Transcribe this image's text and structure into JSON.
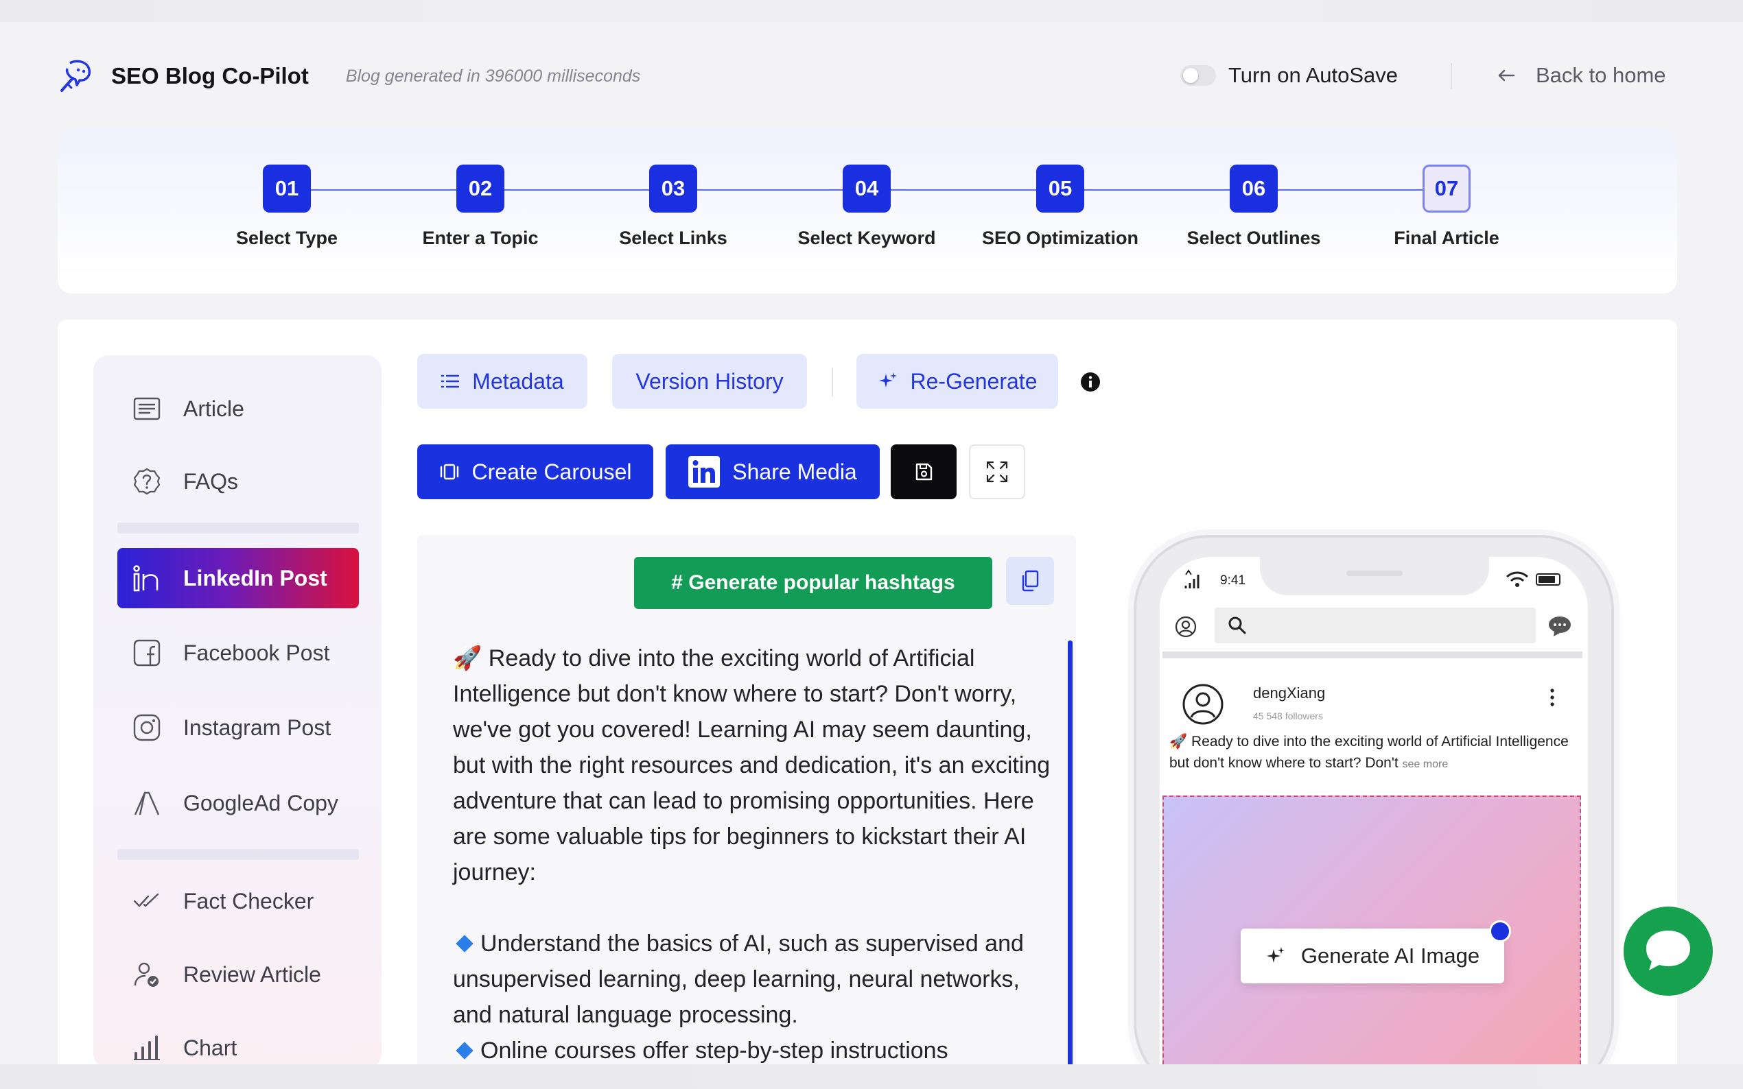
{
  "header": {
    "app_name": "SEO Blog Co-Pilot",
    "generated_note": "Blog generated in 396000 milliseconds",
    "autosave_label": "Turn on AutoSave",
    "autosave_on": false,
    "back_label": "Back to home"
  },
  "steps": [
    {
      "num": "01",
      "label": "Select Type",
      "state": "done"
    },
    {
      "num": "02",
      "label": "Enter a Topic",
      "state": "done"
    },
    {
      "num": "03",
      "label": "Select Links",
      "state": "done"
    },
    {
      "num": "04",
      "label": "Select Keyword",
      "state": "done"
    },
    {
      "num": "05",
      "label": "SEO Optimization",
      "state": "done"
    },
    {
      "num": "06",
      "label": "Select Outlines",
      "state": "done"
    },
    {
      "num": "07",
      "label": "Final Article",
      "state": "current"
    }
  ],
  "sidebar": {
    "items": [
      {
        "label": "Article",
        "icon": "article-icon"
      },
      {
        "label": "FAQs",
        "icon": "question-circle-icon"
      },
      {
        "label": "LinkedIn Post",
        "icon": "linkedin-icon",
        "active": true
      },
      {
        "label": "Facebook Post",
        "icon": "facebook-icon"
      },
      {
        "label": "Instagram Post",
        "icon": "instagram-icon"
      },
      {
        "label": "GoogleAd Copy",
        "icon": "google-ads-icon"
      },
      {
        "label": "Fact Checker",
        "icon": "double-check-icon"
      },
      {
        "label": "Review Article",
        "icon": "user-check-icon"
      },
      {
        "label": "Chart",
        "icon": "bar-chart-icon"
      }
    ]
  },
  "toolbar": {
    "metadata": "Metadata",
    "version_history": "Version History",
    "regenerate": "Re-Generate",
    "create_carousel": "Create Carousel",
    "share_media": "Share Media"
  },
  "editor": {
    "hashtag_button": "# Generate popular hashtags",
    "paragraphs": [
      "Ready to dive into the exciting world of Artificial Intelligence but don't know where to start? Don't worry, we've got you covered! Learning AI may seem daunting, but with the right resources and dedication, it's an exciting adventure that can lead to promising opportunities. Here are some valuable tips for beginners to kickstart their AI journey:",
      "Understand the basics of AI, such as supervised and unsupervised learning, deep learning, neural networks, and natural language processing.",
      "Online courses offer step-by-step instructions"
    ]
  },
  "preview": {
    "time": "9:41",
    "user_name": "dengXiang",
    "followers": "45 548 followers",
    "snippet": "Ready to dive into the exciting world of Artificial Intelligence but don't know where to start? Don't",
    "see_more": "see more",
    "generate_image": "Generate AI Image"
  },
  "colors": {
    "primary": "#1a31df",
    "hashtag_green": "#139c55",
    "chat_green": "#15a14d",
    "active_gradient_start": "#2b22d6",
    "active_gradient_end": "#d8123e"
  }
}
